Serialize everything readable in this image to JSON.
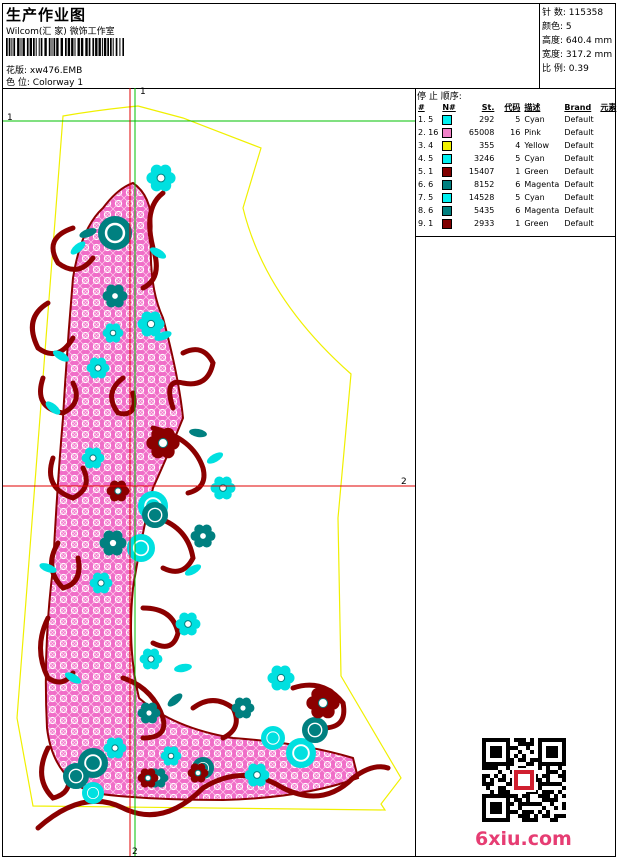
{
  "header": {
    "title": "生产作业图",
    "company": "Wilcom(汇 家) 微饰工作室",
    "design_label": "花版:",
    "design_file": "xw476.EMB",
    "colorway_label": "色 位:",
    "colorway": "Colorway 1"
  },
  "stats": [
    {
      "label": "针 数:",
      "value": "115358"
    },
    {
      "label": "颜色:",
      "value": "5"
    },
    {
      "label": "高度:",
      "value": "640.4 mm"
    },
    {
      "label": "宽度:",
      "value": "317.2 mm"
    },
    {
      "label": "比 例:",
      "value": "0.39"
    }
  ],
  "sequence": {
    "title": "停 止 顺序:",
    "headers": [
      "#",
      "N#",
      "St.",
      "代码",
      "描述",
      "Brand",
      "元素"
    ],
    "rows": [
      {
        "idx": "1. 5",
        "color": "#00f0f0",
        "st": "292",
        "code": "5",
        "desc": "Cyan",
        "brand": "Default"
      },
      {
        "idx": "2. 16",
        "color": "#f080c8",
        "st": "65008",
        "code": "16",
        "desc": "Pink",
        "brand": "Default"
      },
      {
        "idx": "3. 4",
        "color": "#f0f000",
        "st": "355",
        "code": "4",
        "desc": "Yellow",
        "brand": "Default"
      },
      {
        "idx": "4. 5",
        "color": "#00f0f0",
        "st": "3246",
        "code": "5",
        "desc": "Cyan",
        "brand": "Default"
      },
      {
        "idx": "5. 1",
        "color": "#800000",
        "st": "15407",
        "code": "1",
        "desc": "Green",
        "brand": "Default"
      },
      {
        "idx": "6. 6",
        "color": "#008080",
        "st": "8152",
        "code": "6",
        "desc": "Magenta",
        "brand": "Default"
      },
      {
        "idx": "7. 5",
        "color": "#00f0f0",
        "st": "14528",
        "code": "5",
        "desc": "Cyan",
        "brand": "Default"
      },
      {
        "idx": "8. 6",
        "color": "#008080",
        "st": "5435",
        "code": "6",
        "desc": "Magenta",
        "brand": "Default"
      },
      {
        "idx": "9. 1",
        "color": "#800000",
        "st": "2933",
        "code": "1",
        "desc": "Green",
        "brand": "Default"
      }
    ]
  },
  "guides": {
    "h1": "1",
    "v1": "1",
    "h2": "2",
    "v2": "2"
  },
  "watermark": "6xiu.com",
  "colors": {
    "cyan": "#00e0e0",
    "pink": "#f06ec8",
    "maroon": "#8b0000",
    "teal": "#008080",
    "yellow": "#f0f000",
    "guide_green": "#00c000",
    "guide_red": "#e00000"
  }
}
